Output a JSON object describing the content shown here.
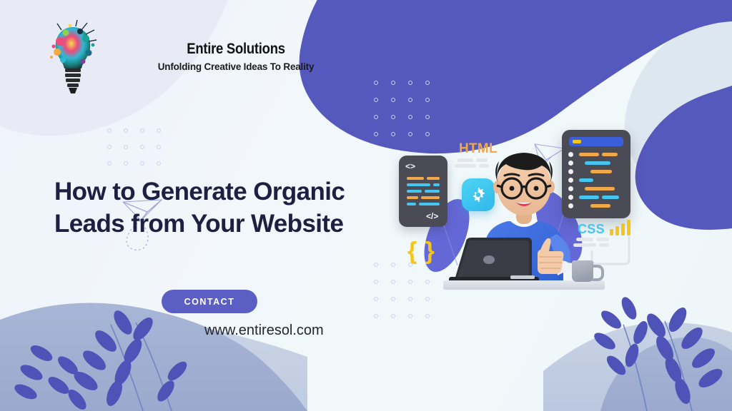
{
  "brand": {
    "name": "Entire Solutions",
    "tagline": "Unfolding Creative Ideas To Reality",
    "logo_icon": "paint-splash-lightbulb-icon"
  },
  "headline": {
    "text": "How to Generate Organic Leads from Your Website"
  },
  "cta": {
    "label": "CONTACT"
  },
  "contact": {
    "url": "www.entiresol.com"
  },
  "illustration": {
    "labels": {
      "html": "HTML",
      "css": "CSS",
      "braces": "{ }",
      "code_open": "<>",
      "code_close": "</>"
    },
    "icons": {
      "gear": "gear-icon",
      "laptop": "laptop-icon",
      "mug": "coffee-mug-icon",
      "person": "developer-character-icon",
      "bar_chart": "bar-chart-icon",
      "paper_plane": "paper-plane-icon",
      "leaf": "leaf-branch-icon"
    }
  },
  "colors": {
    "accent_purple": "#5b5fc4",
    "headline_navy": "#1d2040",
    "code_orange": "#f0a84a",
    "code_cyan": "#45c5ef",
    "panel_dark": "#4b4b56",
    "panel_header_blue": "#3b5fd9",
    "chart_yellow": "#f5c518",
    "sweater_blue": "#3c6ee0",
    "blob_slate": "#9aabcd",
    "background": "#eef5fa"
  }
}
